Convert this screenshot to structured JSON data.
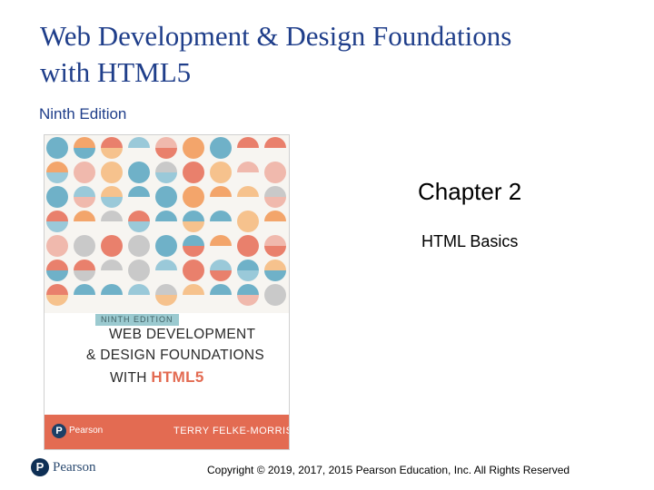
{
  "slide": {
    "title_line1": "Web Development & Design Foundations",
    "title_line2": "with HTML5",
    "edition": "Ninth Edition",
    "chapter": "Chapter 2",
    "subtitle": "HTML Basics",
    "copyright": "Copyright © 2019, 2017, 2015 Pearson Education, Inc. All Rights Reserved"
  },
  "book_cover": {
    "edition_tag": "NINTH EDITION",
    "title_line1": "WEB DEVELOPMENT",
    "title_line2": "& DESIGN FOUNDATIONS",
    "title_line3_prefix": "WITH",
    "title_line3_highlight": "HTML5",
    "publisher": "Pearson",
    "author": "TERRY FELKE-MORRIS",
    "colors": [
      "#e9806c",
      "#f3a56b",
      "#9ac9d9",
      "#6fb1c8",
      "#f0b9ad",
      "#c9c9c9",
      "#f6c28d",
      "#e36b52"
    ]
  },
  "footer": {
    "logo_mark": "P",
    "logo_word": "Pearson"
  }
}
